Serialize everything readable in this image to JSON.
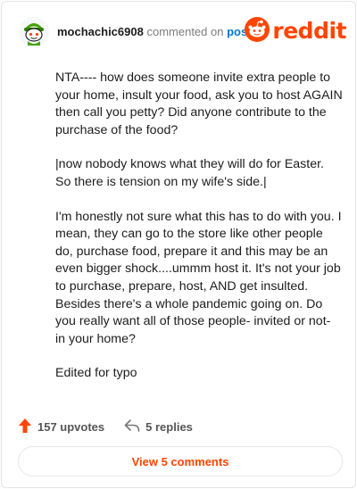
{
  "comment": {
    "username": "mochachic6908",
    "action_text": "commented on",
    "post_link": "post",
    "brand": "reddit",
    "paragraphs": [
      "NTA---- how does someone invite extra people to your home, insult your food, ask you to host AGAIN then call you petty? Did anyone contribute to the purchase of the food?",
      "|now nobody knows what they will do for Easter. So there is tension on my wife's side.|",
      "I'm honestly not sure what this has to do with you. I mean, they can go to the store like other people do, purchase food, prepare it and this may be an even bigger shock....ummm host it. It's not your job to purchase, prepare, host, AND get insulted. Besides there's a whole pandemic going on. Do you really want all of those people- invited or not- in your home?",
      "Edited for typo"
    ],
    "upvotes": "157 upvotes",
    "replies": "5 replies",
    "view_comments": "View 5 comments"
  },
  "colors": {
    "brand": "#ff4500",
    "link": "#0079d3",
    "avatar_green": "#46a508"
  },
  "icons": {
    "avatar": "snoo-avatar-icon",
    "logo": "reddit-snoo-icon",
    "upvote": "upvote-arrow-icon",
    "reply": "reply-arrow-icon"
  }
}
